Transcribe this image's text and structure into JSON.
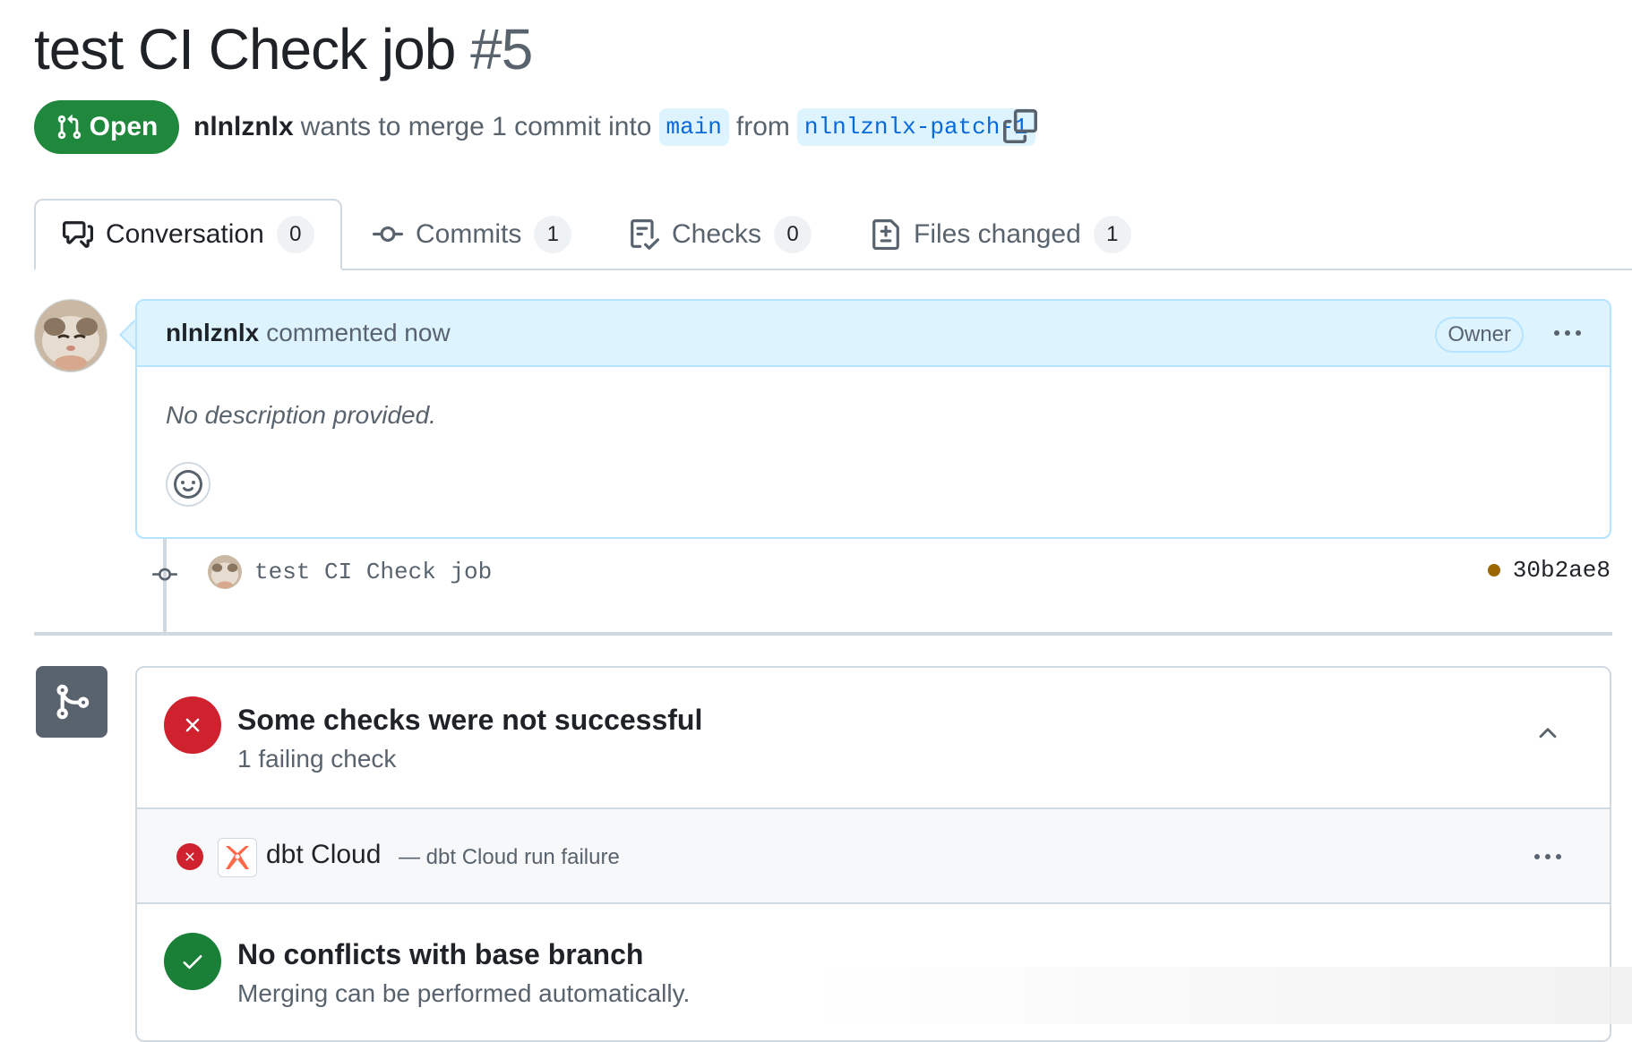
{
  "pr": {
    "title": "test CI Check job",
    "number": "#5",
    "state": "Open",
    "author": "nlnlznlx",
    "merge_text": "wants to merge 1 commit into",
    "base_branch": "main",
    "from_text": "from",
    "head_branch": "nlnlznlx-patch-1"
  },
  "tabs": [
    {
      "label": "Conversation",
      "count": "0",
      "icon": "comment-discussion-icon"
    },
    {
      "label": "Commits",
      "count": "1",
      "icon": "git-commit-icon"
    },
    {
      "label": "Checks",
      "count": "0",
      "icon": "checklist-icon"
    },
    {
      "label": "Files changed",
      "count": "1",
      "icon": "file-diff-icon"
    }
  ],
  "comment": {
    "author": "nlnlznlx",
    "action": "commented now",
    "role": "Owner",
    "body": "No description provided."
  },
  "commit": {
    "message": "test CI Check job",
    "sha": "30b2ae8",
    "status_color": "#9a6700"
  },
  "merge": {
    "checks_title": "Some checks were not successful",
    "checks_subtitle": "1 failing check",
    "check_item": {
      "name": "dbt Cloud",
      "description": "— dbt Cloud run failure"
    },
    "conflict_title": "No conflicts with base branch",
    "conflict_subtitle": "Merging can be performed automatically."
  },
  "colors": {
    "open_green": "#1f883d",
    "fail_red": "#cf222e",
    "success_green": "#1a7f37",
    "accent_blue": "#0969da"
  }
}
